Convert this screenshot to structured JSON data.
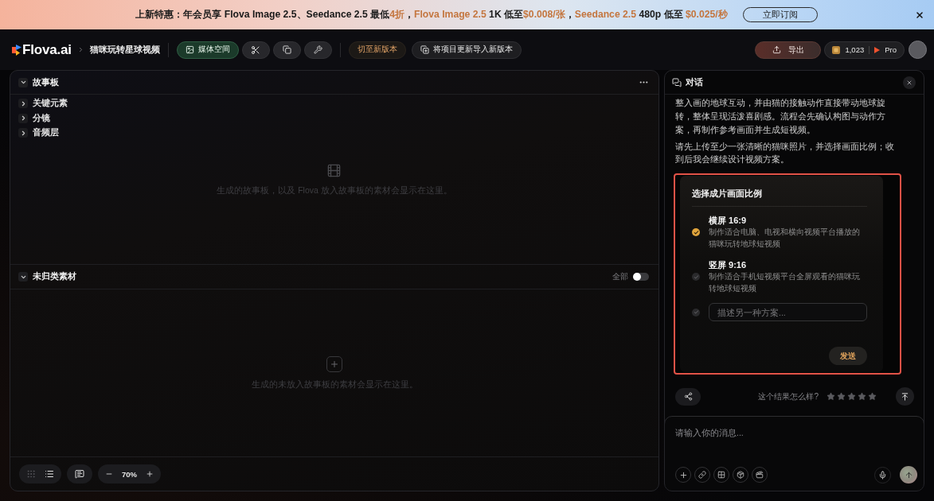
{
  "banner": {
    "segments": [
      {
        "text": "上新特惠：年会员享 Flova Image 2.5、Seedance 2.5 最低",
        "highlight": false
      },
      {
        "text": "4折",
        "highlight": true
      },
      {
        "text": "，",
        "highlight": false
      },
      {
        "text": "Flova Image 2.5",
        "highlight": true
      },
      {
        "text": " 1K 低至",
        "highlight": false
      },
      {
        "text": "$0.008/张",
        "highlight": true
      },
      {
        "text": "，",
        "highlight": false
      },
      {
        "text": "Seedance 2.5",
        "highlight": true
      },
      {
        "text": " 480p 低至 ",
        "highlight": false
      },
      {
        "text": "$0.025/秒",
        "highlight": true
      }
    ],
    "button": "立即订阅"
  },
  "header": {
    "logo": "Flova.ai",
    "project": "猫咪玩转星球视频",
    "tools": [
      {
        "kind": "media",
        "label": "媒体空间",
        "active": true
      },
      {
        "kind": "scissors",
        "active": false
      },
      {
        "kind": "copy",
        "active": false
      },
      {
        "kind": "wrench",
        "active": false
      }
    ],
    "version_actions": [
      {
        "kind": "switch",
        "label": "切至新版本"
      },
      {
        "kind": "import",
        "label": "将项目更新导入新版本"
      }
    ],
    "export": "导出",
    "credits": "1,023",
    "plan": "Pro"
  },
  "storyboard": {
    "title": "故事板",
    "expanded": true,
    "items": [
      {
        "label": "关键元素",
        "expanded": false
      },
      {
        "label": "分镜",
        "expanded": false
      },
      {
        "label": "音频层",
        "expanded": false
      }
    ],
    "empty_text": "生成的故事板，以及 Flova 放入故事板的素材会显示在这里。"
  },
  "unsorted": {
    "title": "未归类素材",
    "expanded": true,
    "filter_label": "全部",
    "filter_on": false,
    "empty_text": "生成的未放入故事板的素材会显示在这里。"
  },
  "toolbar": {
    "views": [
      {
        "kind": "grid",
        "selected": false
      },
      {
        "kind": "list",
        "selected": true
      }
    ],
    "zoom": "70%"
  },
  "chat": {
    "title": "对话",
    "messages": [
      "整入画的地球互动，并由猫的接触动作直接带动地球旋转，整体呈现活泼喜剧感。流程会先确认构图与动作方案，再制作参考画面并生成短视频。",
      "请先上传至少一张清晰的猫咪照片，并选择画面比例；收到后我会继续设计视频方案。"
    ],
    "choice_card": {
      "highlighted": true,
      "title": "选择成片画面比例",
      "options": [
        {
          "kind": "preset",
          "title": "横屏 16:9",
          "description": "制作适合电脑、电视和横向视频平台播放的猫咪玩转地球短视频",
          "selected": true
        },
        {
          "kind": "preset",
          "title": "竖屏 9:16",
          "description": "制作适合手机短视频平台全屏观看的猫咪玩转地球短视频",
          "selected": false
        },
        {
          "kind": "custom",
          "placeholder": "描述另一种方案...",
          "selected": false
        }
      ],
      "submit": "发送"
    },
    "feedback": {
      "question": "这个结果怎么样?",
      "stars": 0
    },
    "composer": {
      "placeholder": "请输入你的消息..."
    }
  }
}
